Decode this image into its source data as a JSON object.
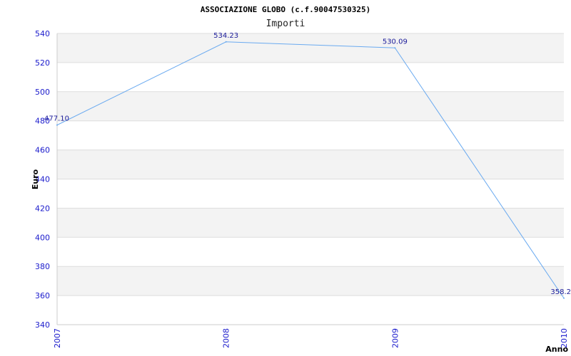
{
  "chart_data": {
    "type": "line",
    "title": "ASSOCIAZIONE GLOBO (c.f.90047530325)",
    "subtitle": "Importi",
    "xlabel": "Anno",
    "ylabel": "Euro",
    "categories": [
      "2007",
      "2008",
      "2009",
      "2010"
    ],
    "series": [
      {
        "values": [
          477.1,
          534.23,
          530.09,
          358.2
        ]
      }
    ],
    "value_labels": [
      "477.10",
      "534.23",
      "530.09",
      "358.2"
    ],
    "ylim": [
      340,
      540
    ],
    "yticks": [
      340,
      360,
      380,
      400,
      420,
      440,
      460,
      480,
      500,
      520,
      540
    ],
    "grid": true,
    "line_color": "#6aaaf0",
    "band_color": "#f3f3f3",
    "tick_color": "#1a1acc"
  }
}
